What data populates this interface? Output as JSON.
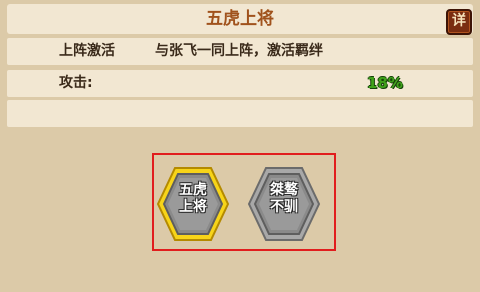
{
  "header": {
    "title": "五虎上将",
    "detail_button": "详"
  },
  "activation": {
    "label": "上阵激活",
    "description": "与张飞一同上阵，激活羁绊"
  },
  "attack": {
    "label": "攻击:",
    "value": "18%"
  },
  "bonds": [
    {
      "line1": "五虎",
      "line2": "上将",
      "selected": true,
      "frame_color": "#f5c800"
    },
    {
      "line1": "桀骜",
      "line2": "不驯",
      "selected": false,
      "frame_color": "#8c8c8c"
    }
  ]
}
